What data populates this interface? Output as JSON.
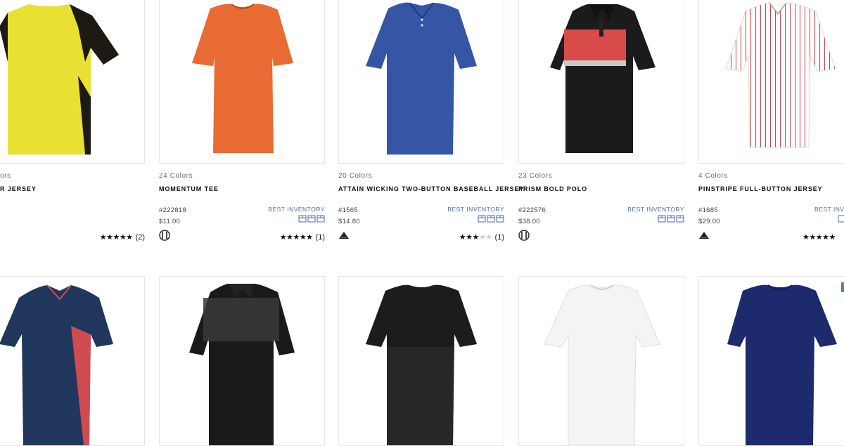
{
  "products_row1": [
    {
      "colors": "24 Colors",
      "name": "MOMENTUM TEE",
      "sku": "#222818",
      "price": "$11.00",
      "inventory": "BEST INVENTORY",
      "stars": 5,
      "reviews": "(1)",
      "brand": "holloway-logo-icon"
    },
    {
      "colors": "20 Colors",
      "name": "ATTAIN WICKING TWO-BUTTON BASEBALL JERSEY",
      "sku": "#1565",
      "price": "$14.80",
      "inventory": "BEST INVENTORY",
      "stars": 3,
      "reviews": "(1)",
      "brand": "augusta-logo-icon"
    },
    {
      "colors": "23 Colors",
      "name": "PRISM BOLD POLO",
      "sku": "#222576",
      "price": "$38.00",
      "inventory": "BEST INVENTORY",
      "stars": null,
      "reviews": null,
      "brand": "holloway-logo-icon"
    },
    {
      "colors": "4 Colors",
      "name": "PINSTRIPE FULL-BUTTON JERSEY",
      "sku": "#1685",
      "price": "$29.00",
      "inventory": "BEST INVE",
      "stars": 5,
      "reviews": "",
      "brand": "augusta-logo-icon"
    }
  ],
  "partial_left": {
    "colors": "ors",
    "name": "R JERSEY",
    "reviews": "(2)",
    "stars": 5
  },
  "colors": {
    "inventory_blue": "#4a6ea8",
    "star": "#111111"
  }
}
